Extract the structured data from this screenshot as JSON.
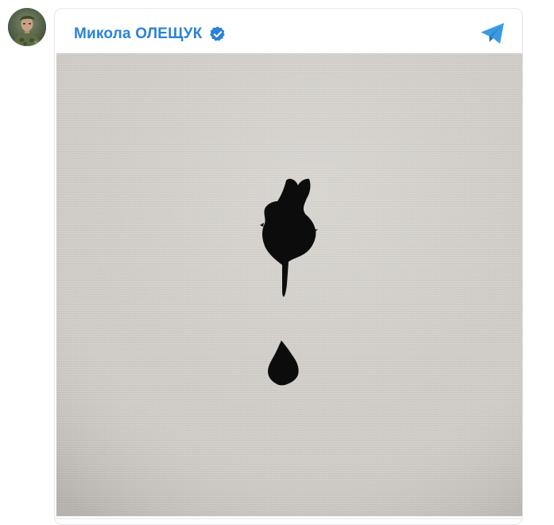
{
  "author": {
    "name": "Микола ОЛЕЩУК",
    "verified": true
  },
  "icons": {
    "avatar": "soldier-portrait-avatar",
    "verified": "verified-badge-icon",
    "share": "telegram-plane-icon"
  },
  "colors": {
    "accent": "#2a82d9",
    "telegram": "#3a9be0",
    "fabric": "#d3d0cb",
    "hole": "#0c0c0c"
  }
}
